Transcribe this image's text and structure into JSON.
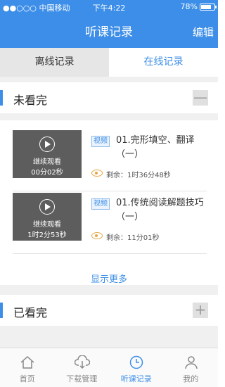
{
  "status_bar": {
    "carrier": "●●○○○ 中国移动",
    "time": "下午4:22",
    "battery": "78%",
    "battery_level": 0.78
  },
  "header": {
    "title": "听课记录",
    "edit_label": "编辑"
  },
  "tabs": [
    {
      "label": "离线记录",
      "active": false
    },
    {
      "label": "在线记录",
      "active": true
    }
  ],
  "unfinished": {
    "title": "未看完",
    "toggle": "—",
    "items": [
      {
        "continue_label": "继续观看",
        "progress_time": "00分02秒",
        "tag": "视频",
        "title": "01.完形填空、翻译（一）",
        "remaining": "剩余：1时36分48秒"
      },
      {
        "continue_label": "继续观看",
        "progress_time": "1时2分53秒",
        "tag": "视频",
        "title": "01.传统阅读解题技巧（一）",
        "remaining": "剩余：11分01秒"
      }
    ],
    "show_more": "显示更多"
  },
  "finished": {
    "title": "已看完",
    "toggle": "+"
  },
  "bottom_nav": [
    {
      "label": "首页",
      "icon": "home-icon",
      "active": false
    },
    {
      "label": "下载管理",
      "icon": "download-cloud-icon",
      "active": false
    },
    {
      "label": "听课记录",
      "icon": "clock-icon",
      "active": true
    },
    {
      "label": "我的",
      "icon": "person-icon",
      "active": false
    }
  ],
  "colors": {
    "accent": "#3d8ee8",
    "eye": "#e6a642",
    "thumb": "#5d5d5d"
  }
}
